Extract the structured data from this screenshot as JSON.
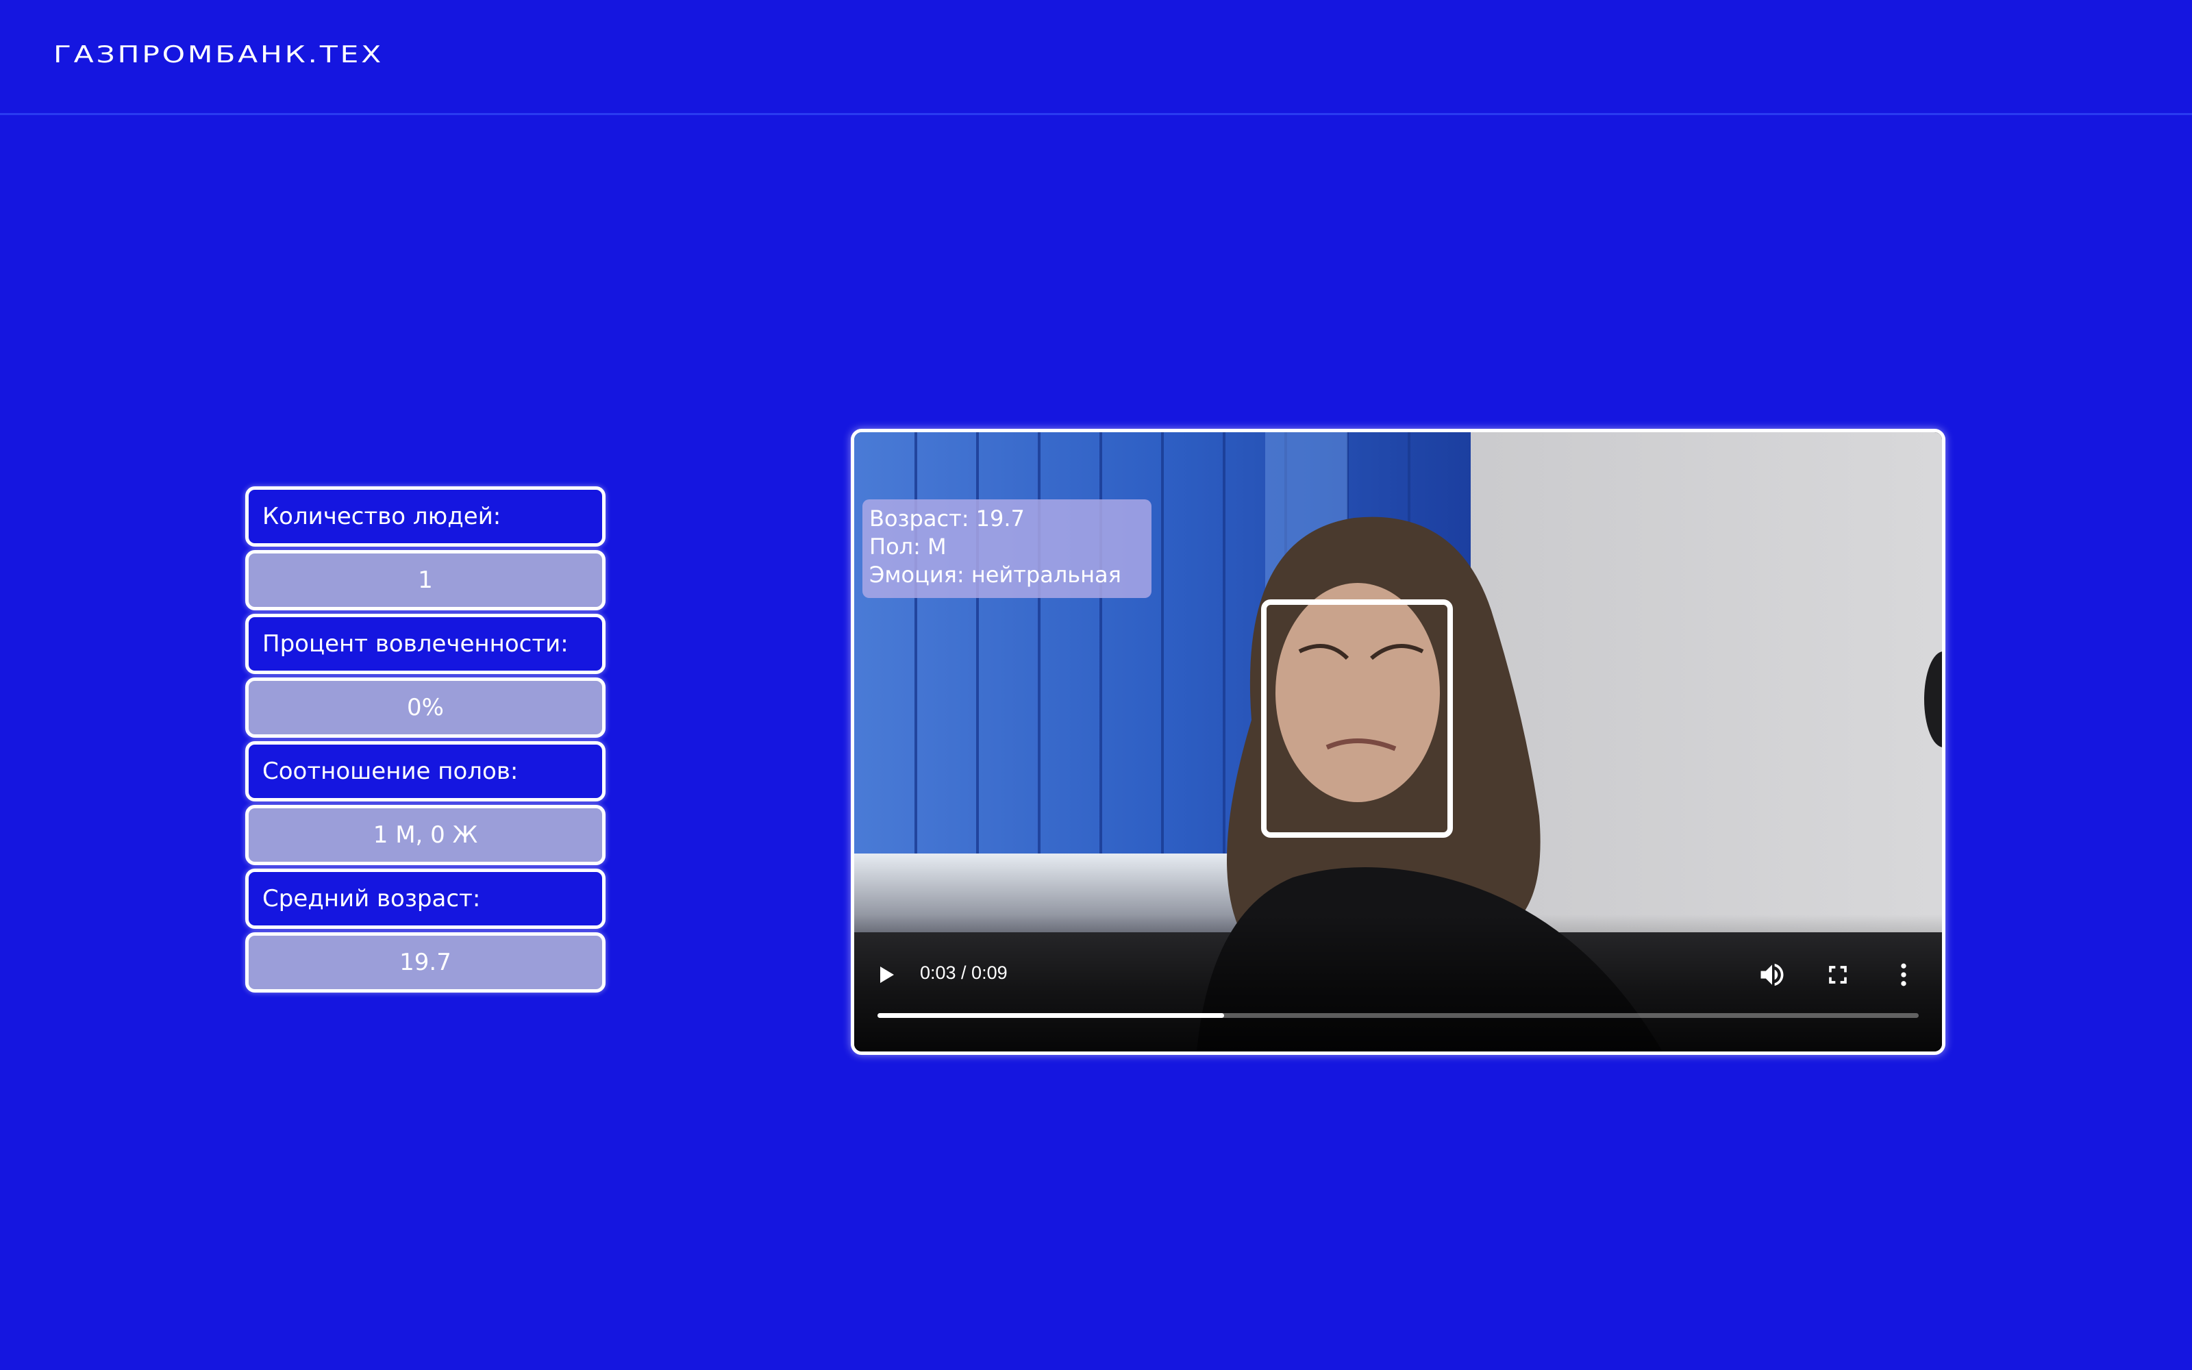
{
  "header": {
    "logo": "ГАЗПРОМБАНК.ТЕХ"
  },
  "stats": [
    {
      "label": "Количество людей:",
      "value": "1"
    },
    {
      "label": "Процент вовлеченности:",
      "value": "0%"
    },
    {
      "label": "Соотношение полов:",
      "value": "1 М, 0 Ж"
    },
    {
      "label": "Средний возраст:",
      "value": "19.7"
    }
  ],
  "video": {
    "overlay": {
      "age": "Возраст: 19.7",
      "gender": "Пол: М",
      "emotion": "Эмоция: нейтральная"
    },
    "time": "0:03 / 0:09",
    "progress_fraction": 0.333,
    "icons": [
      "play-icon",
      "volume-icon",
      "fullscreen-icon",
      "more-options-icon"
    ]
  },
  "colors": {
    "background": "#1516e0",
    "value_box": "#9b9ed9",
    "border": "#ffffff"
  }
}
